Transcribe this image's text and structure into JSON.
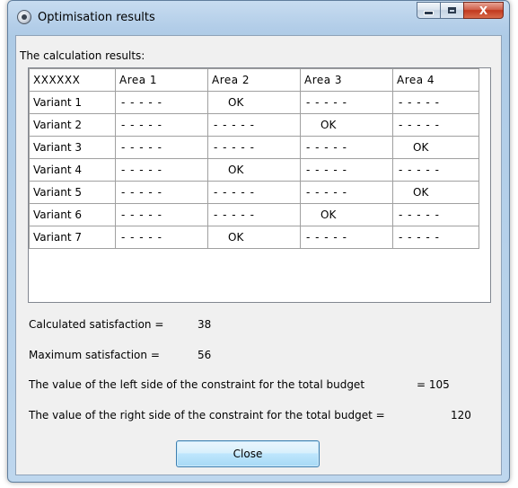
{
  "window": {
    "title": "Optimisation results",
    "icon": "app-icon",
    "controls": {
      "minimize": "minimize",
      "maximize": "maximize",
      "close": "X"
    }
  },
  "main": {
    "results_label": "The calculation results:",
    "table": {
      "headers": [
        "XXXXXX",
        "Area 1",
        "Area 2",
        "Area 3",
        "Area 4"
      ],
      "rows": [
        [
          "Variant 1",
          "-----",
          "OK",
          "-----",
          "-----"
        ],
        [
          "Variant 2",
          "-----",
          "-----",
          "OK",
          "-----"
        ],
        [
          "Variant 3",
          "-----",
          "-----",
          "-----",
          "OK"
        ],
        [
          "Variant 4",
          "-----",
          "OK",
          "-----",
          "-----"
        ],
        [
          "Variant 5",
          "-----",
          "-----",
          "-----",
          "OK"
        ],
        [
          "Variant 6",
          "-----",
          "-----",
          "OK",
          "-----"
        ],
        [
          "Variant 7",
          "-----",
          "OK",
          "-----",
          "-----"
        ]
      ]
    },
    "calculated_satisfaction": {
      "label": "Calculated satisfaction =",
      "value": "38"
    },
    "maximum_satisfaction": {
      "label": "Maximum satisfaction =",
      "value": "56"
    },
    "left_side": {
      "label": "The value of the left side of the constraint for the total budget",
      "value": "= 105"
    },
    "right_side": {
      "label": "The value of the right side of the constraint for the total budget =",
      "value": "120"
    },
    "close_button": "Close"
  }
}
